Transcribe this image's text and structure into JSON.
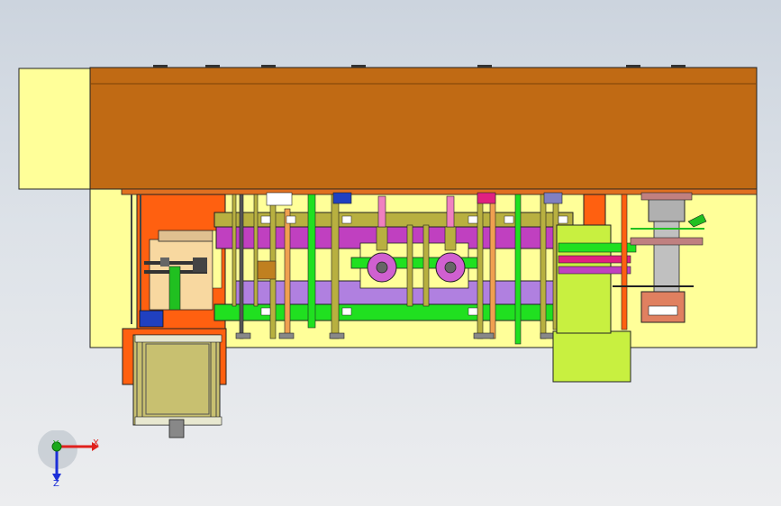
{
  "app": {
    "title": ""
  },
  "viewport": {
    "background_top": "#ccd4de",
    "background_bottom": "#ecedef"
  },
  "triad": {
    "x_label": "X",
    "y_label": "Y",
    "z_label": "Z",
    "x_color": "#e0201c",
    "y_color": "#1aa91a",
    "z_color": "#1c2fd8"
  },
  "colors": {
    "housing": "#c06a14",
    "base": "#ffff99",
    "frame_orange": "#ff6010",
    "rail_green": "#20e020",
    "rail_olive": "#b8b040",
    "purple": "#c040c0",
    "lilac": "#b080e0",
    "cylinder_blue": "#2040c0",
    "motor_olive": "#c8c070",
    "lime_block": "#c8f040",
    "salmon": "#e08060",
    "dark_gray": "#404040"
  },
  "parts": [
    "main-housing",
    "left-end-plate",
    "base-plate",
    "left-orange-frame",
    "right-orange-column",
    "upper-rail",
    "lower-rail",
    "purple-bar",
    "lilac-carriage",
    "roller-left",
    "roller-right",
    "motor-housing",
    "lime-block",
    "right-cylinder",
    "right-actuator"
  ]
}
